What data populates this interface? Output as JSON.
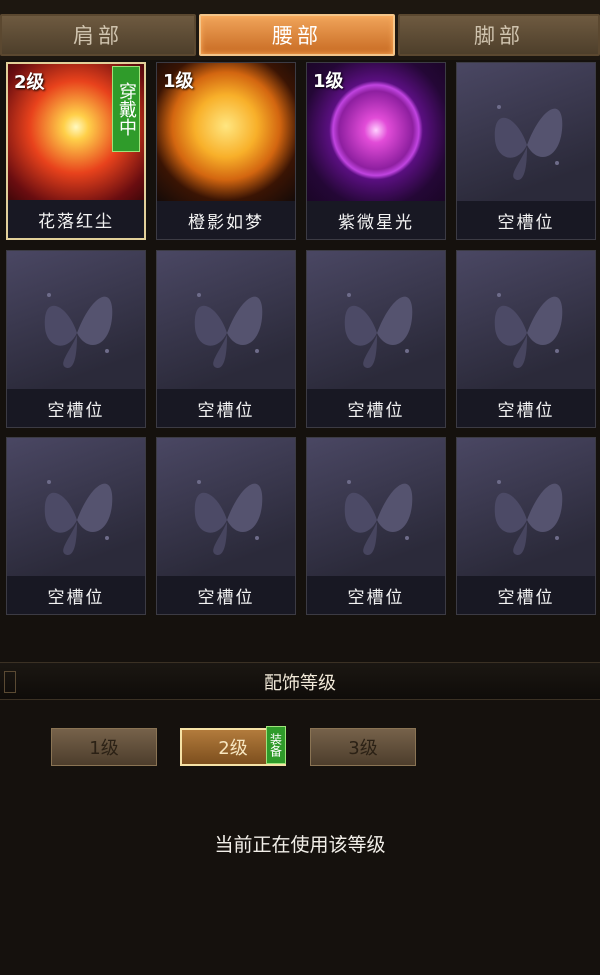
{
  "tabs": [
    {
      "label": "肩部",
      "active": false
    },
    {
      "label": "腰部",
      "active": true
    },
    {
      "label": "脚部",
      "active": false
    }
  ],
  "slots": [
    {
      "caption": "花落红尘",
      "level": "2级",
      "wearing_tag": "穿戴中",
      "art": "fire"
    },
    {
      "caption": "橙影如梦",
      "level": "1级",
      "art": "sun"
    },
    {
      "caption": "紫微星光",
      "level": "1级",
      "art": "orb"
    },
    {
      "caption": "空槽位"
    },
    {
      "caption": "空槽位"
    },
    {
      "caption": "空槽位"
    },
    {
      "caption": "空槽位"
    },
    {
      "caption": "空槽位"
    },
    {
      "caption": "空槽位"
    },
    {
      "caption": "空槽位"
    },
    {
      "caption": "空槽位"
    },
    {
      "caption": "空槽位"
    }
  ],
  "level_section": {
    "title": "配饰等级",
    "buttons": [
      {
        "label": "1级"
      },
      {
        "label": "2级",
        "equipped_tag": "装备"
      },
      {
        "label": "3级"
      }
    ],
    "status": "当前正在使用该等级"
  }
}
